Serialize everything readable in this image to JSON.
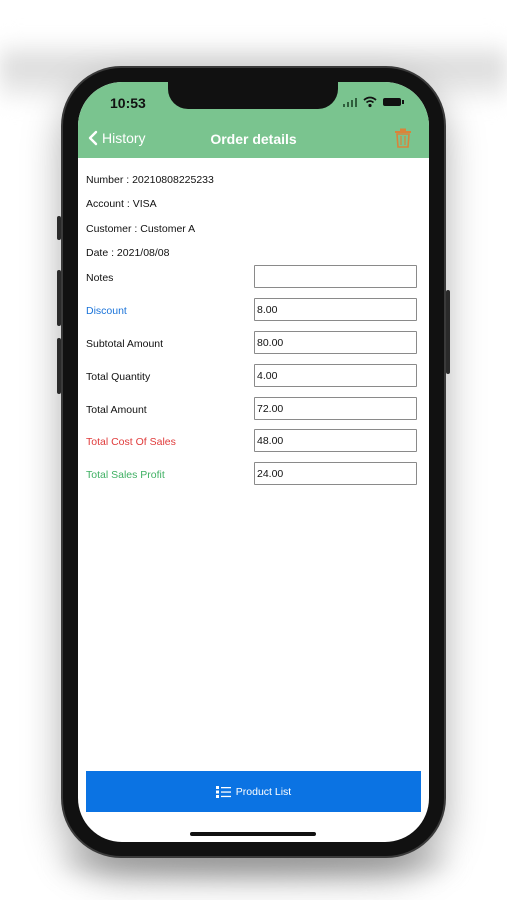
{
  "status_bar": {
    "time": "10:53"
  },
  "nav": {
    "back_label": "History",
    "title": "Order details"
  },
  "order": {
    "number": "Number : 20210808225233",
    "account": "Account : VISA",
    "customer": "Customer : Customer A",
    "date": "Date : 2021/08/08"
  },
  "fields": [
    {
      "label": "Notes",
      "value": "",
      "color": "#111111"
    },
    {
      "label": "Discount",
      "value": "8.00",
      "color": "#1a73d9"
    },
    {
      "label": "Subtotal Amount",
      "value": "80.00",
      "color": "#111111"
    },
    {
      "label": "Total Quantity",
      "value": "4.00",
      "color": "#111111"
    },
    {
      "label": "Total Amount",
      "value": "72.00",
      "color": "#111111"
    },
    {
      "label": "Total Cost Of Sales",
      "value": "48.00",
      "color": "#e03b3b"
    },
    {
      "label": "Total Sales Profit",
      "value": "24.00",
      "color": "#3fb063"
    }
  ],
  "footer": {
    "button_label": "Product List"
  },
  "colors": {
    "header": "#7ac48f",
    "primary_button": "#0b73e3",
    "trash": "#d9843a"
  }
}
